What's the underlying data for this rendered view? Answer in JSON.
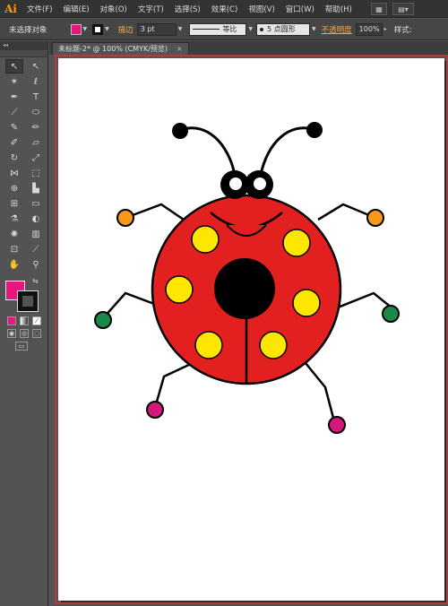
{
  "app": {
    "logo": "Ai"
  },
  "menu": {
    "items": [
      "文件(F)",
      "编辑(E)",
      "对象(O)",
      "文字(T)",
      "选择(S)",
      "效果(C)",
      "视图(V)",
      "窗口(W)",
      "帮助(H)"
    ]
  },
  "control_bar": {
    "selection_status": "未选择对象",
    "fill_color": "#e6157f",
    "stroke_label": "描边",
    "stroke_weight": "3 pt",
    "profile": "等比",
    "brush": "5 点圆形",
    "opacity_label": "不透明度",
    "opacity_value": "100%",
    "style_label": "样式:"
  },
  "document": {
    "tab_title": "未标题-2* @ 100% (CMYK/预览)",
    "close_glyph": "×"
  },
  "tools_panel": {
    "collapse_glyph": "◂◂",
    "fill_color": "#e6157f",
    "stroke_color": "#111111"
  },
  "colors": {
    "body_red": "#e32020",
    "spot_yellow": "#ffe600",
    "outline": "#000000",
    "foot_orange": "#f39a1b",
    "foot_green": "#1a8a4a",
    "foot_pink": "#d6177e",
    "artboard_border": "#b53a3a"
  },
  "icons": {
    "arrange_docs": "arrange-documents-icon",
    "workspace": "workspace-switcher-icon"
  }
}
